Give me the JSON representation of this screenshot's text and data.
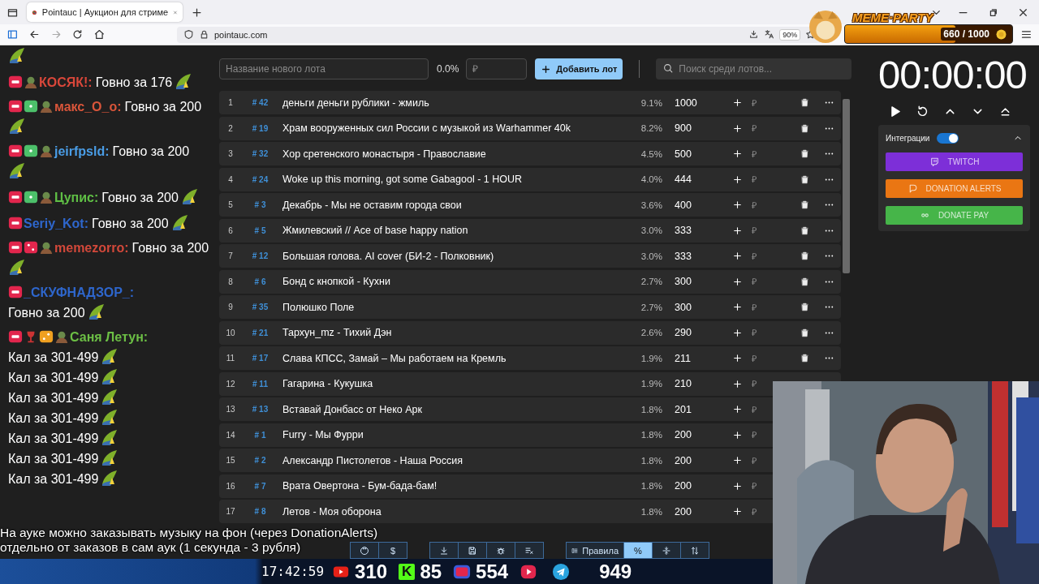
{
  "browser": {
    "tab_title": "Pointauc | Аукцион для стриме",
    "url": "pointauc.com",
    "zoom": "90%"
  },
  "overlay_badge": {
    "title": "MEME·PARTY",
    "progress": "660 / 1000",
    "level": 0.66
  },
  "chat": [
    {
      "parts": [
        {
          "kind": "emote"
        }
      ]
    },
    {
      "badges": [
        {
          "kind": "live"
        },
        {
          "kind": "avatar"
        }
      ],
      "name": "КОСЯК!:",
      "color": "#d9473a",
      "parts": [
        {
          "kind": "text",
          "text": "Говно за 176"
        },
        {
          "kind": "emote"
        }
      ]
    },
    {
      "badges": [
        {
          "kind": "live"
        },
        {
          "kind": "sub"
        },
        {
          "kind": "avatar"
        }
      ],
      "name": "макс_O_o:",
      "color": "#d9553a",
      "parts": [
        {
          "kind": "text",
          "text": "Говно за 200"
        },
        {
          "kind": "emote"
        }
      ]
    },
    {
      "badges": [
        {
          "kind": "live"
        },
        {
          "kind": "sub"
        },
        {
          "kind": "avatar"
        }
      ],
      "name": "jeirfpsld:",
      "color": "#4a9de6",
      "parts": [
        {
          "kind": "text",
          "text": "Говно за 200"
        },
        {
          "kind": "emote"
        }
      ]
    },
    {
      "badges": [
        {
          "kind": "live"
        },
        {
          "kind": "sub"
        },
        {
          "kind": "avatar"
        }
      ],
      "name": "Цупис:",
      "color": "#5fbf45",
      "parts": [
        {
          "kind": "text",
          "text": "Говно за 200"
        },
        {
          "kind": "emote"
        }
      ]
    },
    {
      "badges": [
        {
          "kind": "live"
        }
      ],
      "name": "Seriy_Kot:",
      "color": "#2e66cc",
      "parts": [
        {
          "kind": "text",
          "text": "Говно за 200"
        },
        {
          "kind": "emote"
        }
      ]
    },
    {
      "badges": [
        {
          "kind": "live"
        },
        {
          "kind": "dice"
        },
        {
          "kind": "avatar"
        }
      ],
      "name": "memezorro:",
      "color": "#d2483a",
      "parts": [
        {
          "kind": "text",
          "text": "Говно за 200"
        },
        {
          "kind": "emote"
        }
      ]
    },
    {
      "badges": [
        {
          "kind": "live"
        }
      ],
      "name": "_СКУФНАДЗОР_:",
      "color": "#2e66cc",
      "parts": [
        {
          "kind": "text",
          "text": "Говно за 200"
        },
        {
          "kind": "emote"
        }
      ]
    },
    {
      "badges": [
        {
          "kind": "live"
        },
        {
          "kind": "glass"
        },
        {
          "kind": "domino"
        },
        {
          "kind": "avatar"
        }
      ],
      "name": "Саня Летун:",
      "color": "#6cbf45",
      "parts": [
        {
          "kind": "text",
          "text": "Кал за 301-499"
        },
        {
          "kind": "emote"
        },
        {
          "kind": "text",
          "text": "Кал за 301-499"
        },
        {
          "kind": "emote"
        },
        {
          "kind": "text",
          "text": "Кал за 301-499"
        },
        {
          "kind": "emote"
        },
        {
          "kind": "text",
          "text": "Кал за 301-499"
        },
        {
          "kind": "emote"
        },
        {
          "kind": "text",
          "text": "Кал за 301-499"
        },
        {
          "kind": "emote"
        },
        {
          "kind": "text",
          "text": "Кал за 301-499"
        },
        {
          "kind": "emote"
        },
        {
          "kind": "text",
          "text": "Кал за 301-499"
        },
        {
          "kind": "emote"
        }
      ]
    }
  ],
  "auction": {
    "new_lot_placeholder": "Название нового лота",
    "percent": "0.0%",
    "amount_placeholder": "₽",
    "add_button": "Добавить лот",
    "search_placeholder": "Поиск среди лотов...",
    "lots": [
      {
        "number": "1",
        "id": "# 42",
        "name": "деньги деньги рублики - жмиль",
        "percent": "9.1%",
        "amount": "1000",
        "placeholder": "₽",
        "actions_visible": true
      },
      {
        "number": "2",
        "id": "# 19",
        "name": "Храм вооруженных сил России с музыкой из Warhammer 40k",
        "percent": "8.2%",
        "amount": "900",
        "placeholder": "₽",
        "actions_visible": true
      },
      {
        "number": "3",
        "id": "# 32",
        "name": "Хор сретенского монастыря - Православие",
        "percent": "4.5%",
        "amount": "500",
        "placeholder": "₽",
        "actions_visible": true
      },
      {
        "number": "4",
        "id": "# 24",
        "name": "Woke up this morning, got some Gabagool - 1 HOUR",
        "percent": "4.0%",
        "amount": "444",
        "placeholder": "₽",
        "actions_visible": true
      },
      {
        "number": "5",
        "id": "# 3",
        "name": "Декабрь - Мы не оставим города свои",
        "percent": "3.6%",
        "amount": "400",
        "placeholder": "₽",
        "actions_visible": true
      },
      {
        "number": "6",
        "id": "# 5",
        "name": "Жмилевский // Ace of base happy nation",
        "percent": "3.0%",
        "amount": "333",
        "placeholder": "₽",
        "actions_visible": true
      },
      {
        "number": "7",
        "id": "# 12",
        "name": "Большая голова. AI cover (БИ-2 - Полковник)",
        "percent": "3.0%",
        "amount": "333",
        "placeholder": "₽",
        "actions_visible": true
      },
      {
        "number": "8",
        "id": "# 6",
        "name": "Бонд с кнопкой - Кухни",
        "percent": "2.7%",
        "amount": "300",
        "placeholder": "₽",
        "actions_visible": true
      },
      {
        "number": "9",
        "id": "# 35",
        "name": "Полюшко Поле",
        "percent": "2.7%",
        "amount": "300",
        "placeholder": "₽",
        "actions_visible": true
      },
      {
        "number": "10",
        "id": "# 21",
        "name": "Тархун_mz - Тихий Дэн",
        "percent": "2.6%",
        "amount": "290",
        "placeholder": "₽",
        "actions_visible": true
      },
      {
        "number": "11",
        "id": "# 17",
        "name": "Слава КПСС, Замай – Мы работаем на Кремль",
        "percent": "1.9%",
        "amount": "211",
        "placeholder": "₽",
        "actions_visible": true
      },
      {
        "number": "12",
        "id": "# 11",
        "name": "Гагарина - Кукушка",
        "percent": "1.9%",
        "amount": "210",
        "placeholder": "₽",
        "actions_visible": false
      },
      {
        "number": "13",
        "id": "# 13",
        "name": "Вставай Донбасс от Неко Арк",
        "percent": "1.8%",
        "amount": "201",
        "placeholder": "₽",
        "actions_visible": false
      },
      {
        "number": "14",
        "id": "# 1",
        "name": "Furry - Мы Фурри",
        "percent": "1.8%",
        "amount": "200",
        "placeholder": "₽",
        "actions_visible": false
      },
      {
        "number": "15",
        "id": "# 2",
        "name": "Александр Пистолетов - Наша Россия",
        "percent": "1.8%",
        "amount": "200",
        "placeholder": "₽",
        "actions_visible": false
      },
      {
        "number": "16",
        "id": "# 7",
        "name": "Врата Овертона - Бум-бада-бам!",
        "percent": "1.8%",
        "amount": "200",
        "placeholder": "₽",
        "actions_visible": false
      },
      {
        "number": "17",
        "id": "# 8",
        "name": "Летов - Моя оборона",
        "percent": "1.8%",
        "amount": "200",
        "placeholder": "₽",
        "actions_visible": false
      }
    ]
  },
  "timer": {
    "time": "00:00:00"
  },
  "integrations": {
    "title": "Интеграции",
    "on": true,
    "expanded": true,
    "services": [
      {
        "kind": "twitch",
        "label": "TWITCH"
      },
      {
        "kind": "donationalerts",
        "label": "DONATION ALERTS"
      },
      {
        "kind": "donatepay",
        "label": "DONATE PAY"
      }
    ]
  },
  "toolbar": [
    {
      "items": [
        {
          "kind": "github"
        },
        {
          "kind": "dollar",
          "label": "$"
        }
      ]
    },
    {
      "items": [
        {
          "kind": "download"
        },
        {
          "kind": "save"
        },
        {
          "kind": "bug"
        },
        {
          "kind": "listdelete"
        }
      ]
    },
    {
      "items": [
        {
          "kind": "rules",
          "label": "Правила",
          "selected": false
        },
        {
          "kind": "percent",
          "label": "%",
          "selected": true
        },
        {
          "kind": "collapse",
          "selected": false
        },
        {
          "kind": "sort",
          "selected": false
        }
      ]
    }
  ],
  "caption": [
    "На ауке можно заказывать музыку на фон (через DonationAlerts)",
    "отдельно от заказов в сам аук (1 секунда - 3 рубля)"
  ],
  "stream_bar": {
    "time": "17:42:59",
    "stats": [
      {
        "kind": "youtube",
        "count": "310"
      },
      {
        "kind": "kick",
        "logo": "K",
        "count": "85"
      },
      {
        "kind": "live",
        "count": "554"
      },
      {
        "kind": "rutube"
      },
      {
        "kind": "telegram",
        "count": "949"
      }
    ]
  }
}
